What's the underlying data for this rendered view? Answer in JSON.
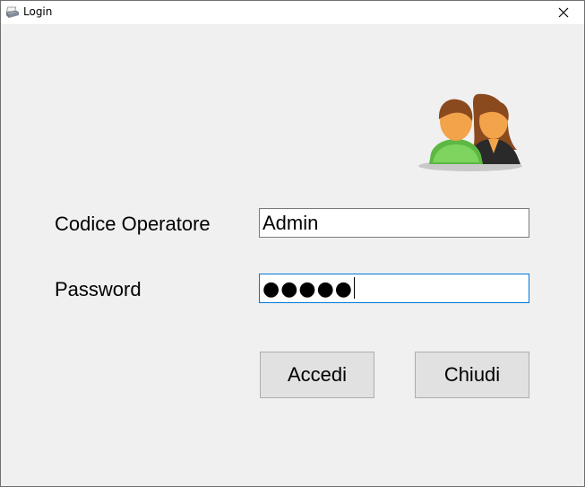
{
  "window": {
    "title": "Login",
    "app_icon": "printer-icon",
    "close_icon": "close-icon"
  },
  "header_icon": "users-icon",
  "form": {
    "operator_code_label": "Codice Operatore",
    "operator_code_value": "Admin",
    "password_label": "Password",
    "password_masked": "●●●●●"
  },
  "buttons": {
    "login_label": "Accedi",
    "close_label": "Chiudi"
  },
  "colors": {
    "background": "#f0f0f0",
    "focus_border": "#0078d7",
    "button_face": "#e1e1e1"
  }
}
